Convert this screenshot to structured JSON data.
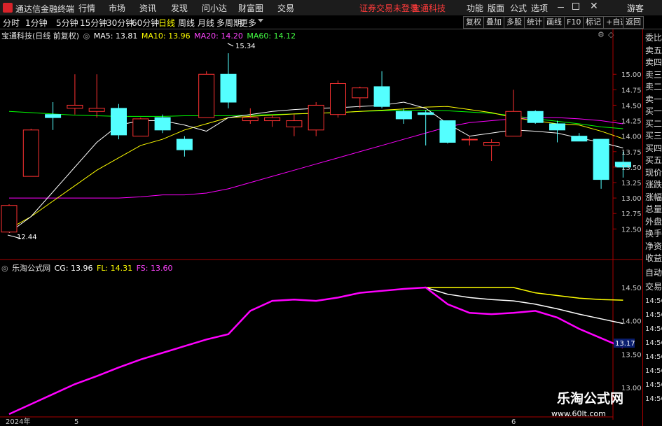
{
  "app_title": "通达信金融终端",
  "menu": [
    "行情",
    "市场",
    "资讯",
    "发现",
    "问小达",
    "财富圈",
    "交易"
  ],
  "broker_notice": "证券交易未登录",
  "broker_name": "宝通科技",
  "menu_right": [
    "功能",
    "版面",
    "公式",
    "选项"
  ],
  "guest": "游客",
  "period_tabs": [
    "分时",
    "1分钟",
    "5分钟",
    "15分钟",
    "30分钟",
    "60分钟",
    "日线",
    "周线",
    "月线",
    "多周期",
    "更多"
  ],
  "active_period": "日线",
  "right_buttons": [
    "复权",
    "叠加",
    "多股",
    "统计",
    "画线",
    "F10",
    "标记",
    "+自选",
    "返回"
  ],
  "main_legend": {
    "stock": "宝通科技(日线 前复权)",
    "ma5": "MA5: 13.81",
    "ma10": "MA10: 13.96",
    "ma20": "MA20: 14.20",
    "ma60": "MA60: 14.12"
  },
  "sub_legend": {
    "name": "乐淘公式网",
    "cg": "CG: 13.96",
    "fl": "FL: 14.31",
    "fs": "FS: 13.60"
  },
  "price_marks": {
    "high": "15.34",
    "low": "12.44"
  },
  "price_axis": [
    "15.00",
    "14.75",
    "14.50",
    "14.25",
    "14.00",
    "13.75",
    "13.50",
    "13.25",
    "13.00",
    "12.75",
    "12.50"
  ],
  "sub_axis": [
    "14.50",
    "14.00",
    "13.50",
    "13.00"
  ],
  "sub_axis_highlight": "13.17",
  "right_panel_labels": [
    "委比",
    "卖五",
    "卖四",
    "卖三",
    "卖二",
    "卖一",
    "买一",
    "买二",
    "买三",
    "买四",
    "买五",
    "现价",
    "涨跌",
    "涨幅",
    "总量",
    "外盘",
    "换手",
    "净资",
    "收益"
  ],
  "right_panel_sub": [
    "自动",
    "交易",
    "14:56",
    "14:56",
    "14:56",
    "14:56",
    "14:56",
    "14:56",
    "14:56",
    "14:56"
  ],
  "date_axis": [
    "2024年",
    "5",
    "6"
  ],
  "watermark": {
    "title": "乐淘公式网",
    "url": "www.60lt.com"
  },
  "colors": {
    "up": "#ff3232",
    "down": "#54ffff",
    "ma5": "#ffffff",
    "ma10": "#ffff00",
    "ma20": "#ff00ff",
    "ma60": "#00ff00"
  },
  "chart_data": {
    "type": "candlestick",
    "ylim": [
      12.3,
      15.5
    ],
    "candles": [
      {
        "o": 12.45,
        "h": 12.9,
        "l": 12.44,
        "c": 12.88
      },
      {
        "o": 13.35,
        "h": 14.12,
        "l": 13.35,
        "c": 14.1
      },
      {
        "o": 14.35,
        "h": 14.55,
        "l": 14.1,
        "c": 14.3
      },
      {
        "o": 14.45,
        "h": 15.0,
        "l": 14.35,
        "c": 14.5
      },
      {
        "o": 14.4,
        "h": 15.0,
        "l": 14.3,
        "c": 14.45
      },
      {
        "o": 14.45,
        "h": 14.52,
        "l": 13.95,
        "c": 14.02
      },
      {
        "o": 14.0,
        "h": 14.3,
        "l": 14.0,
        "c": 14.28
      },
      {
        "o": 14.3,
        "h": 14.35,
        "l": 14.05,
        "c": 14.1
      },
      {
        "o": 13.95,
        "h": 14.0,
        "l": 13.67,
        "c": 13.78
      },
      {
        "o": 14.3,
        "h": 15.05,
        "l": 14.3,
        "c": 15.0
      },
      {
        "o": 15.0,
        "h": 15.34,
        "l": 14.45,
        "c": 14.55
      },
      {
        "o": 14.25,
        "h": 14.45,
        "l": 14.2,
        "c": 14.3
      },
      {
        "o": 14.25,
        "h": 14.35,
        "l": 14.15,
        "c": 14.3
      },
      {
        "o": 14.15,
        "h": 14.35,
        "l": 14.0,
        "c": 14.25
      },
      {
        "o": 14.1,
        "h": 14.55,
        "l": 14.0,
        "c": 14.5
      },
      {
        "o": 14.35,
        "h": 14.9,
        "l": 14.3,
        "c": 14.85
      },
      {
        "o": 14.62,
        "h": 14.8,
        "l": 14.45,
        "c": 14.78
      },
      {
        "o": 14.8,
        "h": 15.05,
        "l": 14.45,
        "c": 14.48
      },
      {
        "o": 14.4,
        "h": 14.45,
        "l": 14.2,
        "c": 14.28
      },
      {
        "o": 14.38,
        "h": 14.42,
        "l": 13.85,
        "c": 14.35
      },
      {
        "o": 14.25,
        "h": 14.25,
        "l": 13.88,
        "c": 13.9
      },
      {
        "o": 13.95,
        "h": 14.0,
        "l": 13.85,
        "c": 13.95
      },
      {
        "o": 13.85,
        "h": 13.95,
        "l": 13.6,
        "c": 13.9
      },
      {
        "o": 14.0,
        "h": 14.75,
        "l": 14.0,
        "c": 14.4
      },
      {
        "o": 14.4,
        "h": 14.42,
        "l": 14.2,
        "c": 14.22
      },
      {
        "o": 14.2,
        "h": 14.25,
        "l": 13.9,
        "c": 14.1
      },
      {
        "o": 14.0,
        "h": 14.05,
        "l": 13.92,
        "c": 13.92
      },
      {
        "o": 13.95,
        "h": 13.95,
        "l": 13.15,
        "c": 13.3
      },
      {
        "o": 13.58,
        "h": 13.75,
        "l": 13.33,
        "c": 13.5
      }
    ],
    "ma5": [
      12.44,
      12.7,
      13.1,
      13.5,
      13.9,
      14.18,
      14.25,
      14.25,
      14.18,
      14.08,
      14.3,
      14.35,
      14.4,
      14.43,
      14.45,
      14.46,
      14.48,
      14.5,
      14.55,
      14.45,
      14.2,
      14.0,
      14.05,
      14.1,
      14.08,
      14.05,
      13.97,
      13.9,
      13.81
    ],
    "ma10": [
      12.5,
      12.7,
      12.95,
      13.2,
      13.45,
      13.65,
      13.85,
      13.95,
      14.1,
      14.2,
      14.3,
      14.32,
      14.34,
      14.36,
      14.37,
      14.38,
      14.4,
      14.42,
      14.44,
      14.47,
      14.48,
      14.43,
      14.38,
      14.3,
      14.25,
      14.2,
      14.18,
      14.08,
      13.96
    ],
    "ma20": [
      13.0,
      13.0,
      13.0,
      13.0,
      13.0,
      13.0,
      13.02,
      13.05,
      13.05,
      13.08,
      13.15,
      13.25,
      13.35,
      13.45,
      13.55,
      13.65,
      13.75,
      13.85,
      13.95,
      14.05,
      14.15,
      14.22,
      14.25,
      14.28,
      14.3,
      14.3,
      14.28,
      14.25,
      14.2
    ],
    "ma60": [
      14.4,
      14.38,
      14.36,
      14.34,
      14.33,
      14.32,
      14.32,
      14.32,
      14.33,
      14.33,
      14.33,
      14.34,
      14.35,
      14.36,
      14.37,
      14.38,
      14.4,
      14.41,
      14.42,
      14.42,
      14.41,
      14.39,
      14.37,
      14.33,
      14.28,
      14.24,
      14.2,
      14.15,
      14.12
    ]
  },
  "sub_chart_data": {
    "type": "line",
    "ylim": [
      12.6,
      14.7
    ],
    "fs": [
      12.6,
      12.75,
      12.9,
      13.05,
      13.17,
      13.3,
      13.42,
      13.52,
      13.62,
      13.72,
      13.8,
      14.15,
      14.3,
      14.32,
      14.3,
      14.35,
      14.42,
      14.45,
      14.48,
      14.5,
      14.25,
      14.12,
      14.1,
      14.12,
      14.15,
      14.05,
      13.88,
      13.74,
      13.6
    ],
    "fl": [
      null,
      null,
      null,
      null,
      null,
      null,
      null,
      null,
      null,
      null,
      null,
      null,
      null,
      null,
      14.35,
      null,
      null,
      null,
      null,
      14.5,
      14.5,
      14.5,
      14.5,
      14.5,
      14.42,
      14.38,
      14.34,
      14.32,
      14.31
    ],
    "cg": [
      null,
      null,
      null,
      null,
      null,
      null,
      null,
      null,
      null,
      null,
      null,
      null,
      null,
      null,
      null,
      null,
      null,
      null,
      null,
      14.5,
      14.4,
      14.35,
      14.32,
      14.3,
      14.25,
      14.18,
      14.1,
      14.03,
      13.96
    ]
  }
}
